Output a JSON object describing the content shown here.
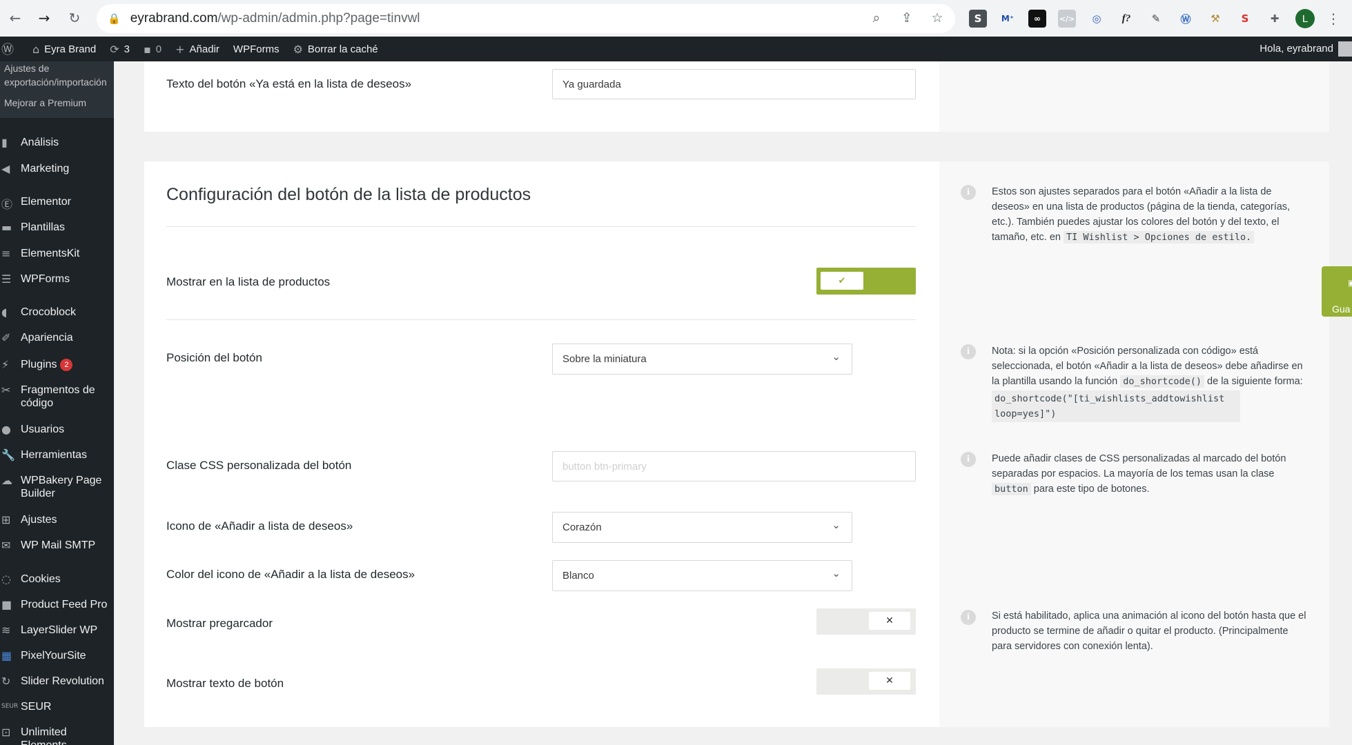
{
  "browser": {
    "url_host": "eyrabrand.com",
    "url_path": "/wp-admin/admin.php?page=tinvwl",
    "back_icon": "arrow-left-icon",
    "forward_icon": "arrow-right-icon",
    "reload_icon": "reload-icon",
    "profile_initial": "L"
  },
  "adminbar": {
    "site_name": "Eyra Brand",
    "updates_count": "3",
    "comments_count": "0",
    "add_new": "Añadir",
    "wpforms": "WPForms",
    "clear_cache": "Borrar la caché",
    "greeting": "Hola, eyrabrand"
  },
  "sidebar": {
    "submenu": {
      "export_settings": "Ajustes de exportación/importación",
      "premium": "Mejorar a Premium"
    },
    "items": [
      {
        "label": "Análisis",
        "icon": "chart-bar-icon"
      },
      {
        "label": "Marketing",
        "icon": "megaphone-icon"
      },
      {
        "label": "Elementor",
        "icon": "elementor-icon"
      },
      {
        "label": "Plantillas",
        "icon": "folder-icon"
      },
      {
        "label": "ElementsKit",
        "icon": "elementskit-icon"
      },
      {
        "label": "WPForms",
        "icon": "form-icon"
      },
      {
        "label": "Crocoblock",
        "icon": "crocoblock-icon"
      },
      {
        "label": "Apariencia",
        "icon": "paintbrush-icon"
      },
      {
        "label": "Plugins",
        "icon": "plugin-icon",
        "badge": "2"
      },
      {
        "label": "Fragmentos de código",
        "icon": "scissors-icon"
      },
      {
        "label": "Usuarios",
        "icon": "users-icon"
      },
      {
        "label": "Herramientas",
        "icon": "wrench-icon"
      },
      {
        "label": "WPBakery Page Builder",
        "icon": "wpbakery-icon"
      },
      {
        "label": "Ajustes",
        "icon": "settings-icon"
      },
      {
        "label": "WP Mail SMTP",
        "icon": "mail-icon"
      },
      {
        "label": "Cookies",
        "icon": "cookie-icon"
      },
      {
        "label": "Product Feed Pro",
        "icon": "feed-icon"
      },
      {
        "label": "LayerSlider WP",
        "icon": "layers-icon"
      },
      {
        "label": "PixelYourSite",
        "icon": "pixel-icon"
      },
      {
        "label": "Slider Revolution",
        "icon": "revolution-icon"
      },
      {
        "label": "SEUR",
        "icon": "seur-icon"
      },
      {
        "label": "Unlimited Elements",
        "icon": "unlimited-icon"
      }
    ]
  },
  "top_panel": {
    "already_label": "Texto del botón «Ya está en la lista de deseos»",
    "already_value": "Ya guardada"
  },
  "section": {
    "title": "Configuración del botón de la lista de productos",
    "intro_text_1": "Estos son ajustes separados para el botón «Añadir a la lista de deseos» en una lista de productos (página de la tienda, categorías, etc.). También puedes ajustar los colores del botón y del texto, el tamaño, etc. en ",
    "intro_code": "TI Wishlist > Opciones de estilo.",
    "show_in_list_label": "Mostrar en la lista de productos",
    "show_in_list_value": true,
    "position_label": "Posición del botón",
    "position_value": "Sobre la miniatura",
    "position_note_1": "Nota: si la opción «Posición personalizada con código» está seleccionada, el botón «Añadir a la lista de deseos» debe añadirse en la plantilla usando la función ",
    "position_note_code": "do_shortcode()",
    "position_note_2": " de la siguiente forma:",
    "position_note_block": "do_shortcode(\"[ti_wishlists_addtowishlist loop=yes]\")",
    "css_class_label": "Clase CSS personalizada del botón",
    "css_class_placeholder": "button btn-primary",
    "css_note_1": "Puede añadir clases de CSS personalizadas al marcado del botón separadas por espacios. La mayoría de los temas usan la clase ",
    "css_note_code": "button",
    "css_note_2": " para este tipo de botones.",
    "icon_label": "Icono de «Añadir a lista de deseos»",
    "icon_value": "Corazón",
    "icon_color_label": "Color del icono de «Añadir a la lista de deseos»",
    "icon_color_value": "Blanco",
    "preloader_label": "Mostrar pregarcador",
    "preloader_value": false,
    "preloader_note": "Si está habilitado, aplica una animación al icono del botón hasta que el producto se termine de añadir o quitar el producto. (Principalmente para servidores con conexión lenta).",
    "button_text_label": "Mostrar texto de botón",
    "button_text_value": false
  },
  "save_tab": {
    "label": "Gua",
    "icon": "save-icon"
  },
  "colors": {
    "accent": "#96b035",
    "admin_bar": "#1d2327"
  }
}
